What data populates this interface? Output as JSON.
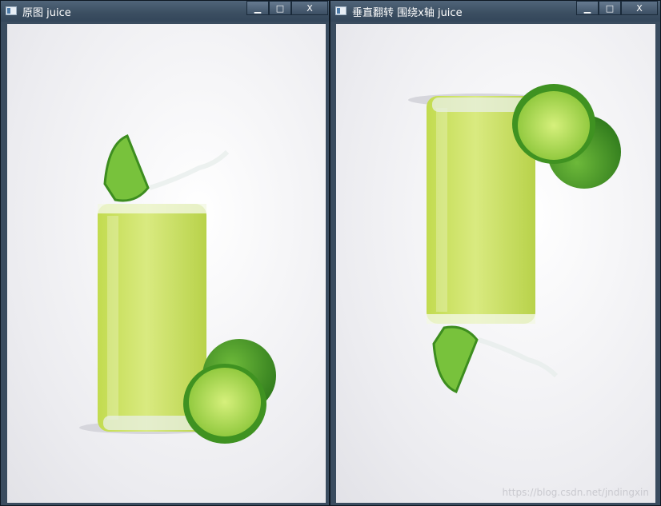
{
  "windows": [
    {
      "title": "原图 juice",
      "buttons": {
        "minimize": "▁",
        "maximize": "□",
        "close": "X"
      }
    },
    {
      "title": "垂直翻转 围绕x轴 juice",
      "buttons": {
        "minimize": "▁",
        "maximize": "□",
        "close": "X"
      }
    }
  ],
  "watermark": "https://blog.csdn.net/jndingxin",
  "icons": [
    "app-window-icon",
    "minimize-icon",
    "maximize-icon",
    "close-icon"
  ]
}
